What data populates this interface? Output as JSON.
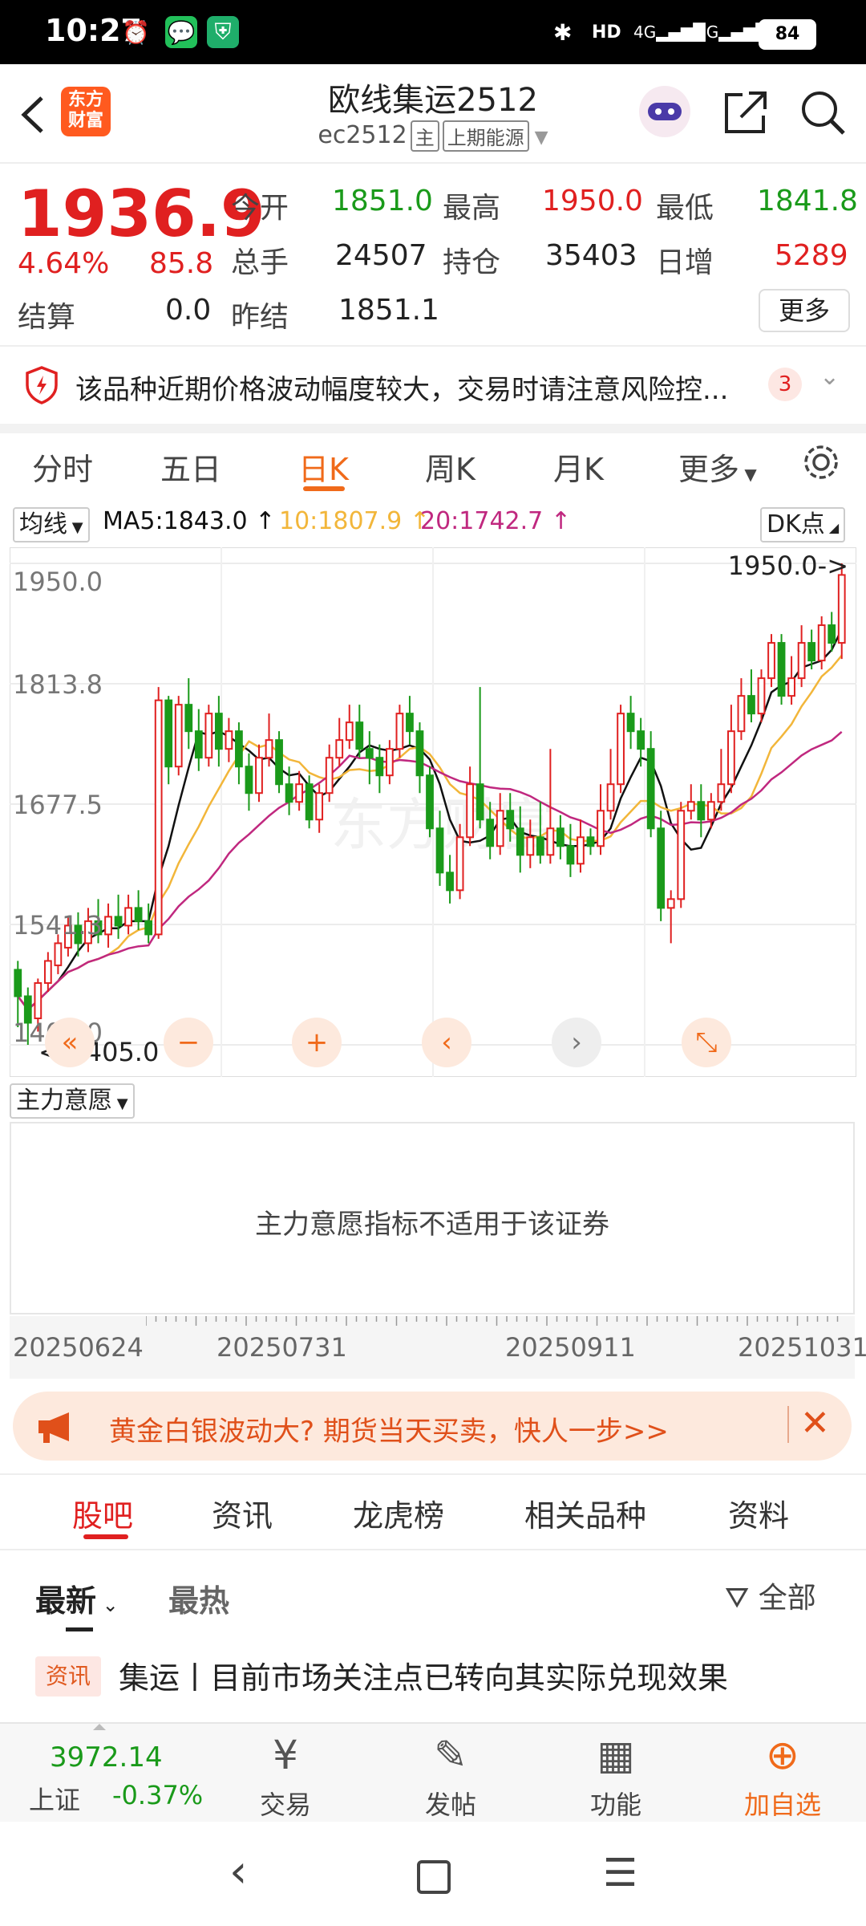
{
  "status_bar": {
    "time": "10:27",
    "network": "4G",
    "network2": "5G",
    "hd": "HD",
    "battery": "84"
  },
  "header": {
    "logo_text": "东方财富",
    "title": "欧线集运2512",
    "code": "ec2512",
    "main_tag": "主",
    "exchange": "上期能源"
  },
  "quote": {
    "price": "1936.9",
    "change_pct": "4.64%",
    "change": "85.8",
    "fields": [
      {
        "label": "今开",
        "value": "1851.0",
        "color": "green"
      },
      {
        "label": "最高",
        "value": "1950.0",
        "color": "red"
      },
      {
        "label": "最低",
        "value": "1841.8",
        "color": "green"
      },
      {
        "label": "总手",
        "value": "24507",
        "color": "black"
      },
      {
        "label": "持仓",
        "value": "35403",
        "color": "black"
      },
      {
        "label": "日增",
        "value": "5289",
        "color": "red"
      },
      {
        "label": "结算",
        "value": "0.0",
        "color": "black"
      },
      {
        "label": "昨结",
        "value": "1851.1",
        "color": "black"
      }
    ],
    "more_label": "更多"
  },
  "risk": {
    "text": "该品种近期价格波动幅度较大，交易时请注意风险控...",
    "count": "3"
  },
  "period_tabs": [
    "分时",
    "五日",
    "日K",
    "周K",
    "月K",
    "更多"
  ],
  "chart_controls": {
    "ma_button": "均线",
    "ma5": "MA5:1843.0",
    "ma10": "10:1807.9",
    "ma20": "20:1742.7",
    "dk_button": "DK点",
    "high_marker": "1950.0->",
    "low_marker": "<-1405.0",
    "indicator_button": "主力意愿",
    "indicator_msg": "主力意愿指标不适用于该证券",
    "watermark": "东方财富"
  },
  "colors": {
    "up": "#e02020",
    "down": "#1a9a1a",
    "accent": "#f06a1a",
    "ma5": "#111111",
    "ma10": "#f2b63a",
    "ma20": "#c0287f"
  },
  "chart_data": {
    "type": "candlestick",
    "y_ticks": [
      "1950.0",
      "1813.8",
      "1677.5",
      "1541.3",
      "1405.0"
    ],
    "ylim": [
      1405.0,
      1950.0
    ],
    "x_ticks": [
      "20250624",
      "20250731",
      "20250911",
      "20251031"
    ],
    "ma_last": {
      "MA5": 1843.0,
      "MA10": 1807.9,
      "MA20": 1742.7
    },
    "candles": [
      [
        1490,
        1460,
        1500,
        1425
      ],
      [
        1460,
        1430,
        1470,
        1405
      ],
      [
        1435,
        1475,
        1480,
        1420
      ],
      [
        1475,
        1500,
        1510,
        1465
      ],
      [
        1495,
        1520,
        1530,
        1485
      ],
      [
        1515,
        1540,
        1550,
        1505
      ],
      [
        1540,
        1520,
        1555,
        1505
      ],
      [
        1520,
        1545,
        1560,
        1510
      ],
      [
        1545,
        1530,
        1570,
        1520
      ],
      [
        1530,
        1550,
        1565,
        1515
      ],
      [
        1550,
        1540,
        1575,
        1525
      ],
      [
        1540,
        1560,
        1575,
        1530
      ],
      [
        1560,
        1545,
        1580,
        1535
      ],
      [
        1545,
        1530,
        1565,
        1520
      ],
      [
        1530,
        1795,
        1810,
        1525
      ],
      [
        1795,
        1720,
        1800,
        1700
      ],
      [
        1720,
        1790,
        1800,
        1710
      ],
      [
        1790,
        1760,
        1820,
        1740
      ],
      [
        1760,
        1730,
        1785,
        1715
      ],
      [
        1730,
        1780,
        1790,
        1720
      ],
      [
        1780,
        1740,
        1800,
        1720
      ],
      [
        1740,
        1760,
        1775,
        1725
      ],
      [
        1760,
        1720,
        1770,
        1700
      ],
      [
        1720,
        1690,
        1735,
        1670
      ],
      [
        1690,
        1730,
        1745,
        1680
      ],
      [
        1730,
        1750,
        1780,
        1720
      ],
      [
        1750,
        1700,
        1760,
        1690
      ],
      [
        1700,
        1680,
        1720,
        1665
      ],
      [
        1680,
        1700,
        1715,
        1670
      ],
      [
        1700,
        1660,
        1710,
        1650
      ],
      [
        1660,
        1690,
        1700,
        1645
      ],
      [
        1690,
        1730,
        1745,
        1680
      ],
      [
        1730,
        1750,
        1775,
        1720
      ],
      [
        1750,
        1770,
        1790,
        1740
      ],
      [
        1770,
        1740,
        1790,
        1730
      ],
      [
        1740,
        1730,
        1760,
        1700
      ],
      [
        1730,
        1710,
        1745,
        1690
      ],
      [
        1710,
        1740,
        1750,
        1700
      ],
      [
        1740,
        1780,
        1790,
        1730
      ],
      [
        1780,
        1760,
        1800,
        1745
      ],
      [
        1760,
        1710,
        1770,
        1690
      ],
      [
        1710,
        1650,
        1720,
        1640
      ],
      [
        1650,
        1600,
        1670,
        1585
      ],
      [
        1600,
        1580,
        1620,
        1565
      ],
      [
        1580,
        1640,
        1655,
        1570
      ],
      [
        1640,
        1700,
        1720,
        1630
      ],
      [
        1700,
        1660,
        1810,
        1650
      ],
      [
        1660,
        1630,
        1680,
        1615
      ],
      [
        1630,
        1670,
        1690,
        1620
      ],
      [
        1670,
        1650,
        1690,
        1635
      ],
      [
        1650,
        1620,
        1675,
        1600
      ],
      [
        1620,
        1640,
        1660,
        1605
      ],
      [
        1640,
        1620,
        1680,
        1610
      ],
      [
        1620,
        1650,
        1740,
        1610
      ],
      [
        1650,
        1630,
        1665,
        1615
      ],
      [
        1630,
        1610,
        1655,
        1595
      ],
      [
        1610,
        1640,
        1660,
        1600
      ],
      [
        1640,
        1630,
        1650,
        1620
      ],
      [
        1630,
        1670,
        1700,
        1620
      ],
      [
        1670,
        1700,
        1740,
        1660
      ],
      [
        1700,
        1780,
        1790,
        1690
      ],
      [
        1780,
        1760,
        1800,
        1740
      ],
      [
        1760,
        1740,
        1775,
        1720
      ],
      [
        1740,
        1650,
        1760,
        1640
      ],
      [
        1650,
        1560,
        1670,
        1545
      ],
      [
        1560,
        1570,
        1580,
        1520
      ],
      [
        1570,
        1670,
        1680,
        1560
      ],
      [
        1670,
        1680,
        1700,
        1660
      ],
      [
        1680,
        1660,
        1700,
        1640
      ],
      [
        1660,
        1680,
        1690,
        1650
      ],
      [
        1680,
        1700,
        1740,
        1670
      ],
      [
        1700,
        1760,
        1790,
        1690
      ],
      [
        1760,
        1800,
        1820,
        1750
      ],
      [
        1800,
        1780,
        1830,
        1770
      ],
      [
        1780,
        1820,
        1830,
        1770
      ],
      [
        1820,
        1860,
        1870,
        1810
      ],
      [
        1860,
        1800,
        1870,
        1790
      ],
      [
        1800,
        1820,
        1845,
        1790
      ],
      [
        1820,
        1860,
        1880,
        1810
      ],
      [
        1860,
        1840,
        1875,
        1830
      ],
      [
        1840,
        1880,
        1890,
        1830
      ],
      [
        1880,
        1860,
        1895,
        1850
      ],
      [
        1860,
        1936.9,
        1950,
        1841.8
      ]
    ]
  },
  "ad": {
    "text": "黄金白银波动大? 期货当天买卖，快人一步>>"
  },
  "section_tabs": [
    "股吧",
    "资讯",
    "龙虎榜",
    "相关品种",
    "资料"
  ],
  "sort_tabs": {
    "latest": "最新",
    "hot": "最热",
    "filter": "全部"
  },
  "news": [
    {
      "tag": "资讯",
      "title": "集运丨目前市场关注点已转向其实际兑现效果"
    }
  ],
  "bottom_bar": {
    "index_value": "3972.14",
    "index_name": "上证",
    "index_change": "-0.37%",
    "items": [
      {
        "label": "交易",
        "icon": "¥"
      },
      {
        "label": "发帖",
        "icon": "✎"
      },
      {
        "label": "功能",
        "icon": "▦"
      },
      {
        "label": "加自选",
        "icon": "⊕"
      }
    ]
  }
}
